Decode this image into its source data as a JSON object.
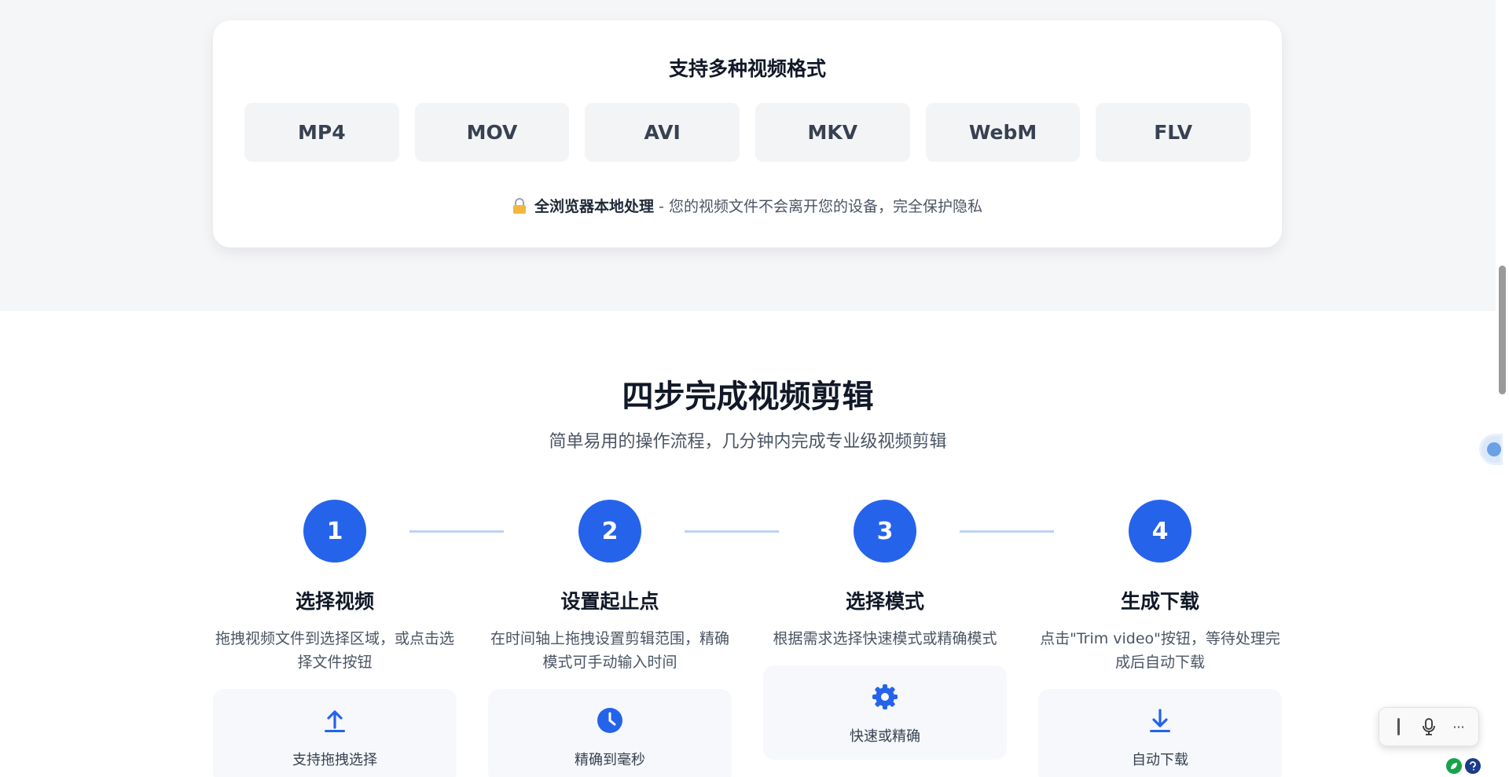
{
  "formats": {
    "title": "支持多种视频格式",
    "items": [
      "MP4",
      "MOV",
      "AVI",
      "MKV",
      "WebM",
      "FLV"
    ],
    "privacy_strong": "全浏览器本地处理",
    "privacy_rest": " - 您的视频文件不会离开您的设备，完全保护隐私"
  },
  "steps": {
    "title": "四步完成视频剪辑",
    "subtitle": "简单易用的操作流程，几分钟内完成专业级视频剪辑",
    "items": [
      {
        "number": "1",
        "title": "选择视频",
        "desc": "拖拽视频文件到选择区域，或点击选择文件按钮",
        "card_label": "支持拖拽选择",
        "card_icon": "upload-icon"
      },
      {
        "number": "2",
        "title": "设置起止点",
        "desc": "在时间轴上拖拽设置剪辑范围，精确模式可手动输入时间",
        "card_label": "精确到毫秒",
        "card_icon": "clock-icon"
      },
      {
        "number": "3",
        "title": "选择模式",
        "desc": "根据需求选择快速模式或精确模式",
        "card_label": "快速或精确",
        "card_icon": "gear-icon"
      },
      {
        "number": "4",
        "title": "生成下载",
        "desc": "点击\"Trim video\"按钮，等待处理完成后自动下载",
        "card_label": "自动下载",
        "card_icon": "download-icon"
      }
    ]
  },
  "toolbar": {
    "more_label": "···"
  },
  "colors": {
    "accent": "#2563eb",
    "connector": "#bcd3f7",
    "band": "#f5f6f8"
  }
}
